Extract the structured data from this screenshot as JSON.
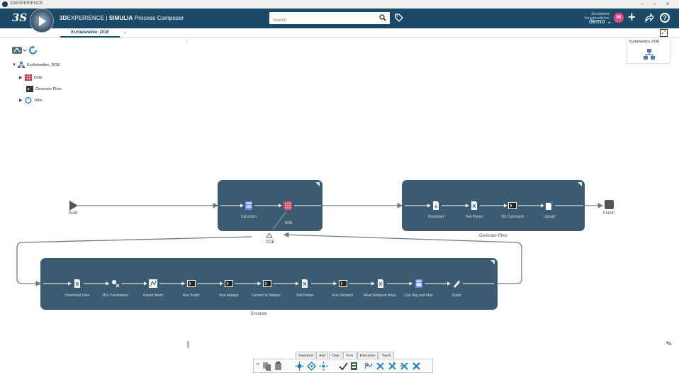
{
  "window": {
    "title": "3DEXPERIENCE",
    "controls": [
      "–",
      "▫",
      "×"
    ]
  },
  "appbar": {
    "brand_bold": "3D",
    "brand_rest": "EXPERIENCE | ",
    "brand_app": "SIMULIA",
    "brand_module": " Process Composer",
    "search_placeholder": "Search",
    "user_subtitle": "Simulations Verantwortlicher",
    "user_name": "demo ⌄",
    "notification_count": "99",
    "plus": "+",
    "help": "?"
  },
  "tabs": {
    "active_label": "Kurbelwellen_DOE",
    "add": "+",
    "maximize": "⤢"
  },
  "tree": {
    "splitter": "⁞",
    "items": [
      {
        "label": "Kurbelwellen_DOE",
        "tri": "▼"
      },
      {
        "label": "DOE",
        "tri": "▶"
      },
      {
        "label": "Generate Plots",
        "tri": ""
      },
      {
        "label": "Jobs",
        "tri": "▶"
      }
    ]
  },
  "thumbnail": {
    "label": "Kurbelwellen_DOE"
  },
  "workflow": {
    "start_label": "Start",
    "finish_label": "Finish",
    "doe_block": {
      "caption": "DOE",
      "components": [
        "Calculator",
        "DOE"
      ]
    },
    "plots_block": {
      "caption": "Generate Plots",
      "components": [
        "Download",
        "Text Parser",
        "OS Command",
        "Upload"
      ]
    },
    "simulate_block": {
      "caption": "Simulate",
      "components": [
        "Download Files",
        "3DX Parameters",
        "Export Mesh",
        "Run Script",
        "Run Abaqus",
        "Convert to Simpac..",
        "Text Parser",
        "Run Simpack",
        "Read Simpack Resu..",
        "Calc Avg and Max",
        "Script"
      ]
    }
  },
  "actionbar": {
    "tabs": [
      "Standard",
      "Add",
      "Data",
      "View",
      "Execution",
      "Touch"
    ],
    "active_tab": "View"
  },
  "colors": {
    "appbar": "#1a4a68",
    "block": "#3b5b72",
    "connector": "#6b7d8a"
  }
}
